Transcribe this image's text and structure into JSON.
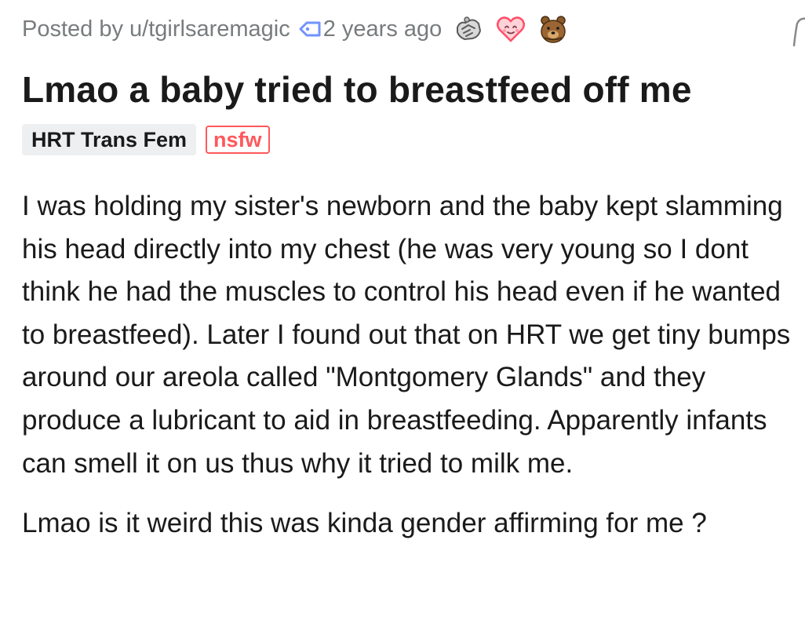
{
  "post": {
    "meta": {
      "posted_by": "Posted by u/tgirlsaremagic",
      "time_ago": "2 years ago",
      "awards": [
        {
          "icon": "handshake-award-icon"
        },
        {
          "icon": "heart-face-award-icon"
        },
        {
          "icon": "bear-award-icon"
        }
      ]
    },
    "title": "Lmao a baby tried to breastfeed off me",
    "flair": "HRT Trans Fem",
    "nsfw_label": "nsfw",
    "body": [
      "I was holding my sister's newborn and the baby kept slamming his head directly into my chest (he was very young so I dont think he had the muscles to control his head even if he wanted to breastfeed). Later I found out that on HRT we get tiny bumps around our areola called \"Montgomery Glands\" and they produce a lubricant to aid in breastfeeding. Apparently infants can smell it on us thus why it tried to milk me.",
      "Lmao is it weird this was kinda gender affirming for me ?"
    ],
    "colors": {
      "meta_text": "#787c7e",
      "tag_icon": "#7193ff",
      "nsfw": "#ff585b",
      "flair_bg": "#edeff1",
      "text": "#1a1a1b"
    }
  }
}
